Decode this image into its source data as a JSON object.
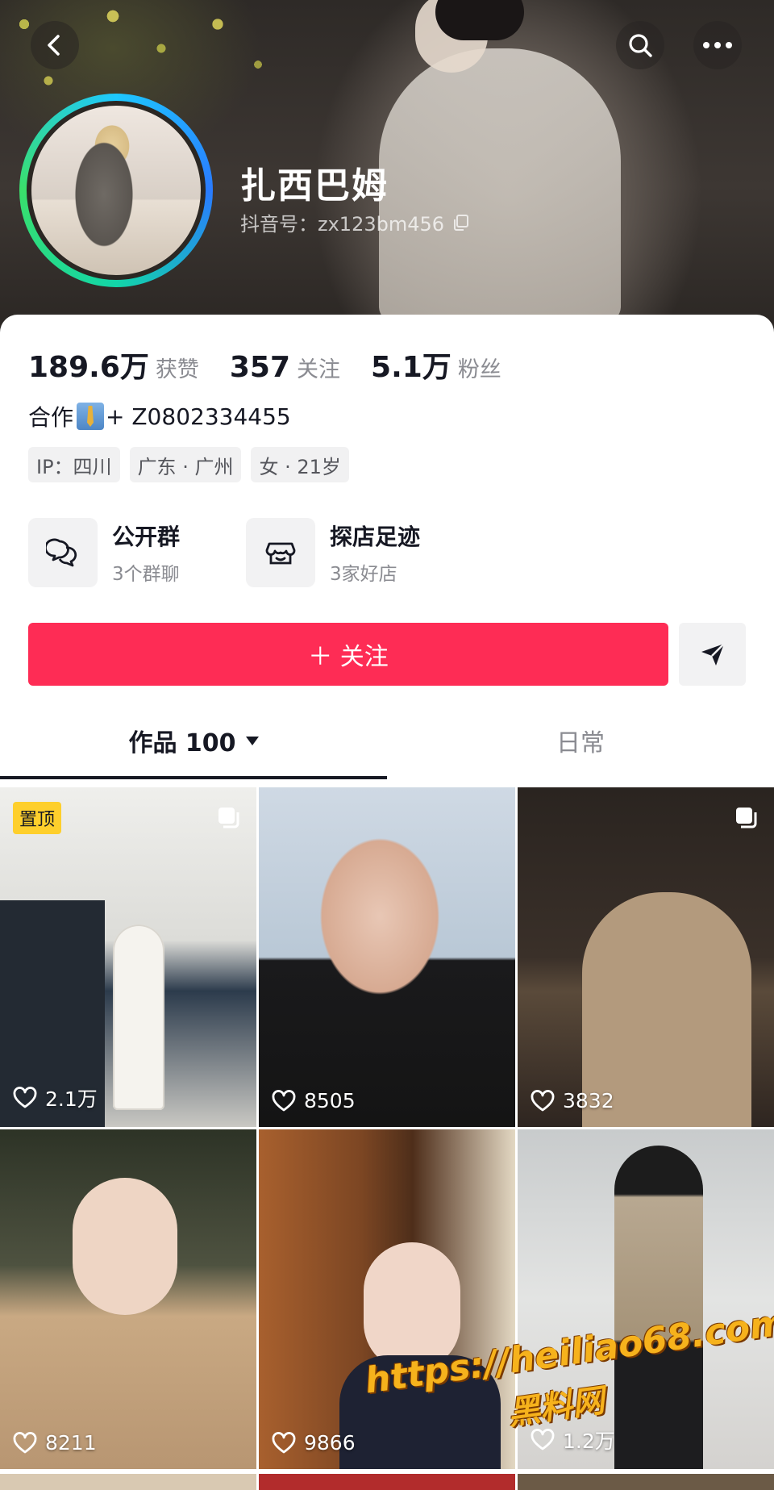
{
  "profile": {
    "nickname": "扎西巴姆",
    "douyin_id": "抖音号：zx123bm456"
  },
  "stats": [
    {
      "value": "189.6万",
      "label": "获赞"
    },
    {
      "value": "357",
      "label": "关注"
    },
    {
      "value": "5.1万",
      "label": "粉丝"
    }
  ],
  "bio": {
    "prefix": "合作",
    "icon": "necktie-emoji",
    "suffix": "+ Z0802334455"
  },
  "tags": [
    "IP：四川",
    "广东 · 广州",
    "女 · 21岁"
  ],
  "features": [
    {
      "title": "公开群",
      "subtitle": "3个群聊",
      "icon": "chat-bubbles-icon"
    },
    {
      "title": "探店足迹",
      "subtitle": "3家好店",
      "icon": "shop-icon"
    }
  ],
  "actions": {
    "follow_label": "＋ 关注",
    "share_icon": "send-icon"
  },
  "tabs": {
    "works_label": "作品 100",
    "daily_label": "日常"
  },
  "videos": [
    {
      "likes": "2.1万",
      "pinned_label": "置顶",
      "multi": true
    },
    {
      "likes": "8505",
      "multi": false
    },
    {
      "likes": "3832",
      "multi": true
    },
    {
      "likes": "8211",
      "multi": false
    },
    {
      "likes": "9866",
      "multi": false
    },
    {
      "likes": "1.2万",
      "multi": false
    }
  ],
  "watermark": {
    "line1": "https://heiliao68.com",
    "line2": "黑料网"
  },
  "colors": {
    "follow_button": "#fe2c55",
    "pin_badge": "#fecf2c"
  }
}
